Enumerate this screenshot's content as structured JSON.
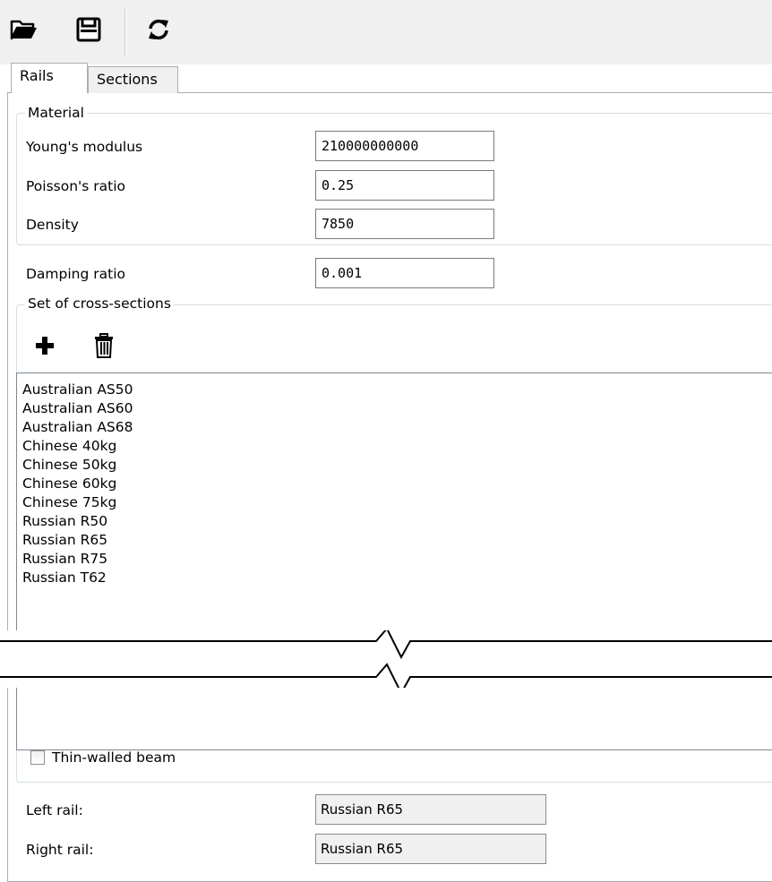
{
  "toolbar": {
    "open_icon": "folder-open-icon",
    "save_icon": "save-disk-icon",
    "refresh_icon": "refresh-icon"
  },
  "tabs": [
    {
      "label": "Rails",
      "active": true
    },
    {
      "label": "Sections",
      "active": false
    }
  ],
  "material": {
    "title": "Material",
    "youngs_label": "Young's modulus",
    "youngs_value": "210000000000",
    "poisson_label": "Poisson's ratio",
    "poisson_value": "0.25",
    "density_label": "Density",
    "density_value": "7850"
  },
  "damping": {
    "label": "Damping ratio",
    "value": "0.001"
  },
  "cross_sections": {
    "title": "Set of cross-sections",
    "add_icon": "plus-icon",
    "delete_icon": "trash-icon",
    "items": [
      "Australian AS50",
      "Australian AS60",
      "Australian AS68",
      "Chinese 40kg",
      "Chinese 50kg",
      "Chinese 60kg",
      "Chinese 75kg",
      "Russian R50",
      "Russian R65",
      "Russian R75",
      "Russian T62"
    ],
    "thin_walled_label": "Thin-walled beam",
    "thin_walled_checked": false
  },
  "rails": {
    "left_label": "Left rail:",
    "left_value": "Russian R65",
    "right_label": "Right rail:",
    "right_value": "Russian R65"
  }
}
